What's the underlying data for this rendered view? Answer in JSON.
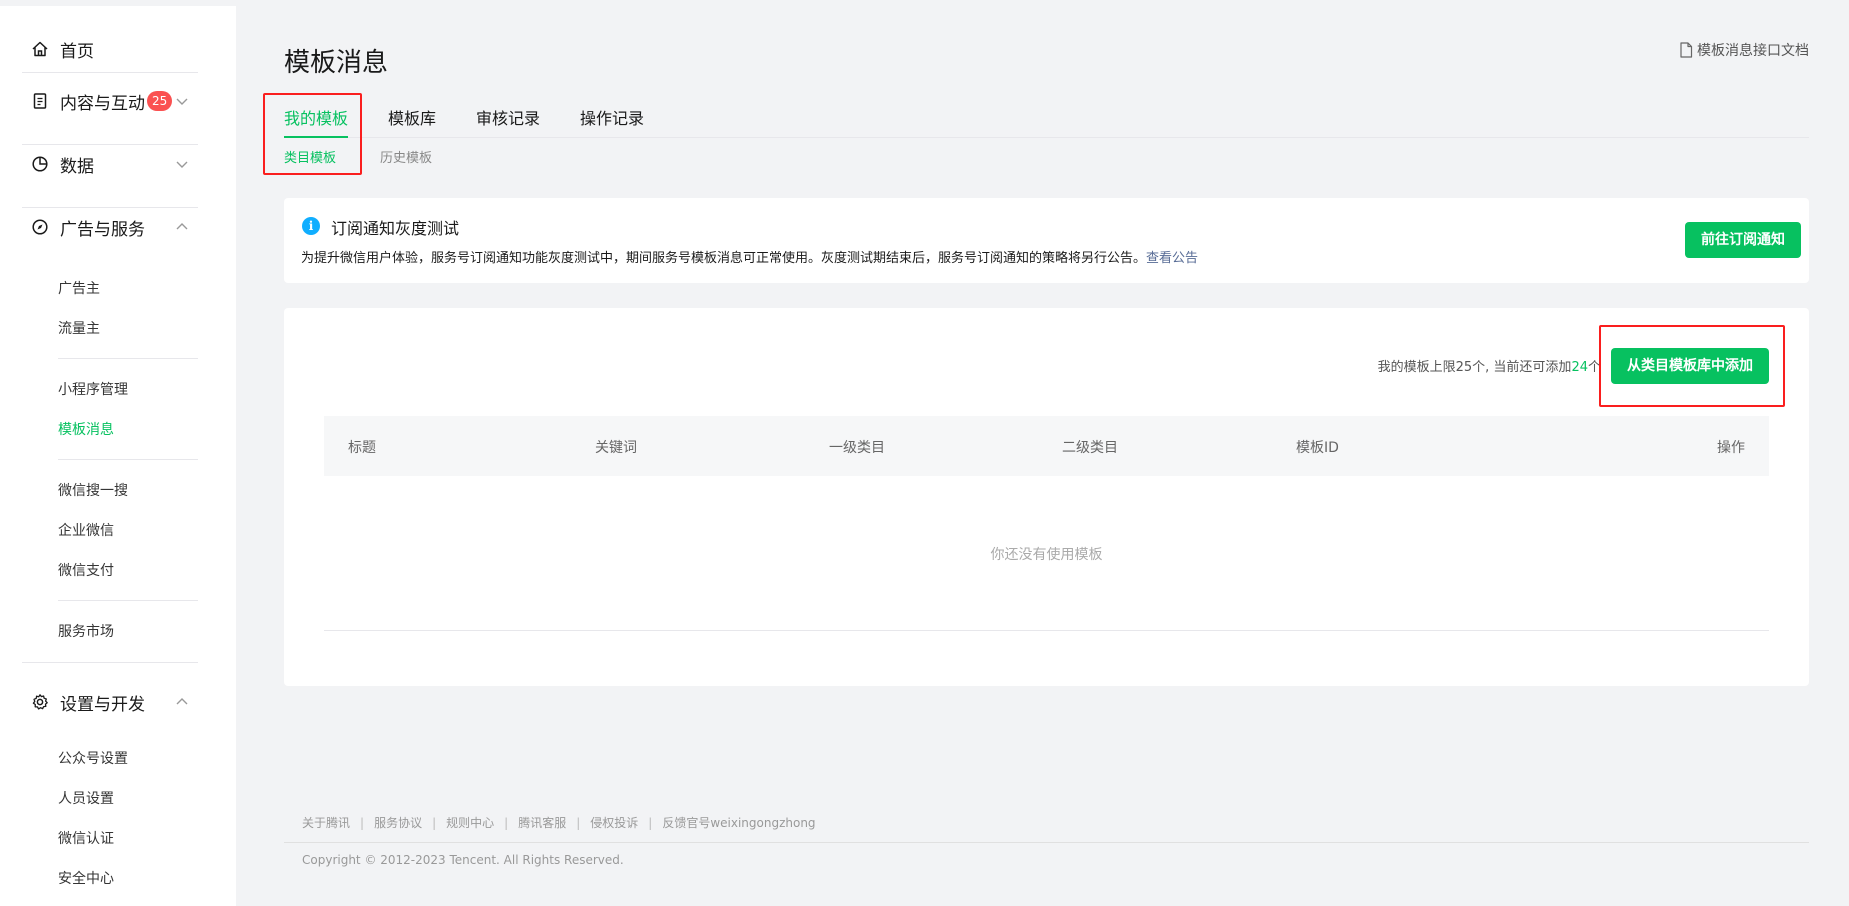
{
  "sidebar": {
    "home": "首页",
    "content": "内容与互动",
    "content_badge": "25",
    "data": "数据",
    "ads": "广告与服务",
    "ads_items": [
      "广告主",
      "流量主",
      "小程序管理",
      "模板消息",
      "微信搜一搜",
      "企业微信",
      "微信支付",
      "服务市场"
    ],
    "settings": "设置与开发",
    "settings_items": [
      "公众号设置",
      "人员设置",
      "微信认证",
      "安全中心"
    ]
  },
  "header": {
    "title": "模板消息",
    "doc_link": "模板消息接口文档"
  },
  "tabs": [
    "我的模板",
    "模板库",
    "审核记录",
    "操作记录"
  ],
  "subtabs": [
    "类目模板",
    "历史模板"
  ],
  "notice": {
    "title": "订阅通知灰度测试",
    "desc": "为提升微信用户体验，服务号订阅通知功能灰度测试中，期间服务号模板消息可正常使用。灰度测试期结束后，服务号订阅通知的策略将另行公告。",
    "link": "查看公告",
    "button": "前往订阅通知"
  },
  "list": {
    "quota_prefix": "我的模板上限25个, 当前还可添加",
    "quota_num": "24",
    "quota_suffix": "个",
    "add_button": "从类目模板库中添加",
    "columns": [
      "标题",
      "关键词",
      "一级类目",
      "二级类目",
      "模板ID",
      "操作"
    ],
    "empty": "你还没有使用模板"
  },
  "footer": {
    "links": [
      "关于腾讯",
      "服务协议",
      "规则中心",
      "腾讯客服",
      "侵权投诉",
      "反馈官号weixingongzhong"
    ],
    "copyright": "Copyright © 2012-2023 Tencent. All Rights Reserved."
  },
  "colors": {
    "accent": "#07c160",
    "badge": "#fa5151",
    "highlight": "#fa1e1e",
    "link": "#576b95"
  }
}
